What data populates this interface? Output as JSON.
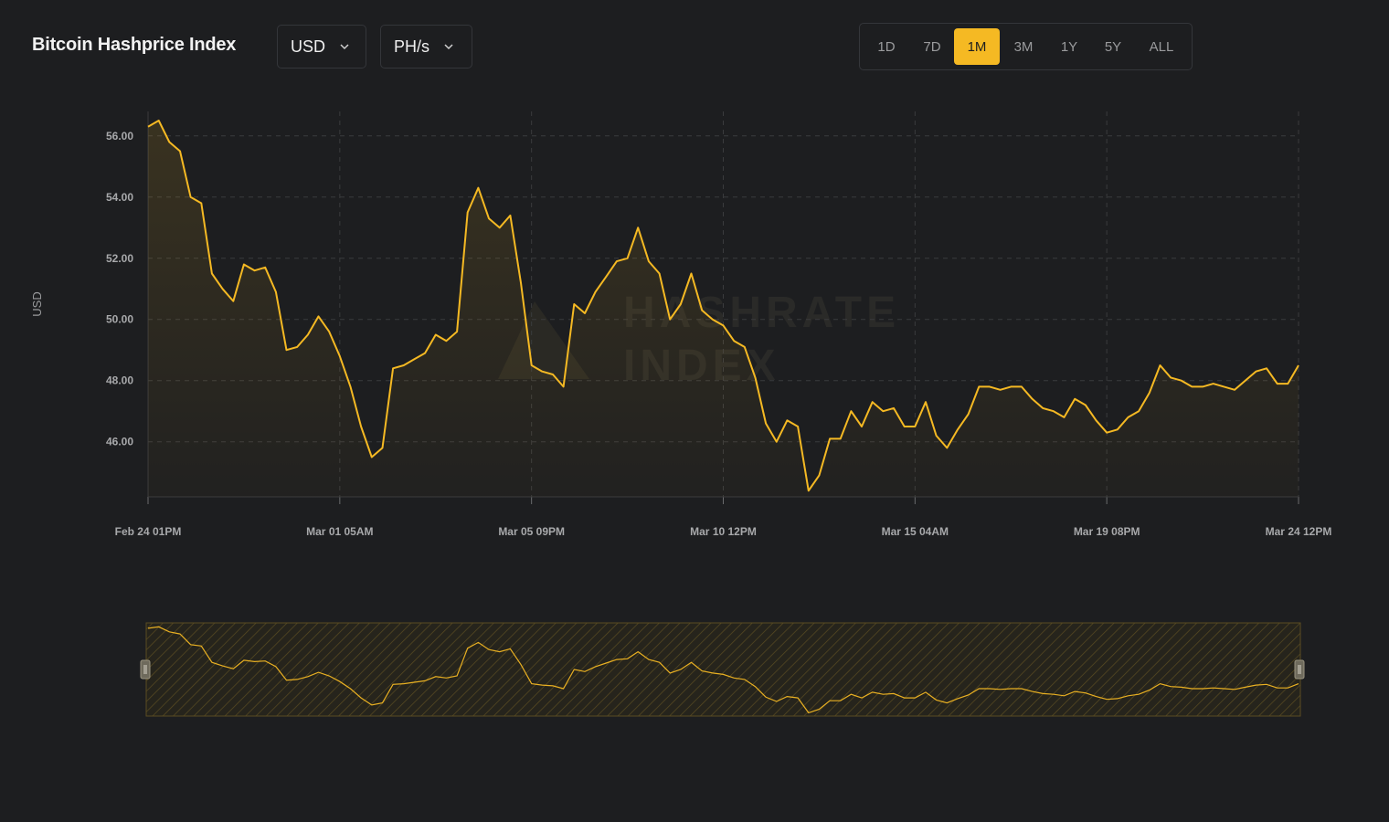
{
  "header": {
    "title": "Bitcoin Hashprice Index",
    "currency": "USD",
    "unit": "PH/s",
    "ranges": [
      "1D",
      "7D",
      "1M",
      "3M",
      "1Y",
      "5Y",
      "ALL"
    ],
    "active_range": "1M"
  },
  "colors": {
    "accent": "#f5b923",
    "background": "#1d1e20",
    "grid": "#3a3b3d"
  },
  "icons": {
    "dropdown": "chevron-down-icon",
    "slider_handle": "drag-handle-icon",
    "watermark": "hashrate-index-logo"
  },
  "watermark": [
    "HASHRATE",
    "INDEX"
  ],
  "chart_data": {
    "type": "area",
    "ylabel": "USD",
    "ylim": [
      44.2,
      56.8
    ],
    "yticks": [
      46,
      48,
      50,
      52,
      54,
      56
    ],
    "ytick_labels": [
      "46.00",
      "48.00",
      "50.00",
      "52.00",
      "54.00",
      "56.00"
    ],
    "xtick_labels": [
      "Feb 24 01PM",
      "Mar 01 05AM",
      "Mar 05 09PM",
      "Mar 10 12PM",
      "Mar 15 04AM",
      "Mar 19 08PM",
      "Mar 24 12PM"
    ],
    "x_start": "Feb 24 01PM",
    "x_end": "Mar 24 12PM",
    "grid": true,
    "series": [
      {
        "values": [
          56.3,
          56.5,
          55.8,
          55.5,
          54.0,
          53.8,
          51.5,
          51.0,
          50.6,
          51.8,
          51.6,
          51.7,
          50.9,
          49.0,
          49.1,
          49.5,
          50.1,
          49.6,
          48.8,
          47.8,
          46.5,
          45.5,
          45.8,
          48.4,
          48.5,
          48.7,
          48.9,
          49.5,
          49.3,
          49.6,
          53.5,
          54.3,
          53.3,
          53.0,
          53.4,
          51.2,
          48.5,
          48.3,
          48.2,
          47.8,
          50.5,
          50.2,
          50.9,
          51.4,
          51.9,
          52.0,
          53.0,
          51.9,
          51.5,
          50.0,
          50.5,
          51.5,
          50.3,
          50.0,
          49.8,
          49.3,
          49.1,
          48.1,
          46.6,
          46.0,
          46.7,
          46.5,
          44.4,
          44.9,
          46.1,
          46.1,
          47.0,
          46.5,
          47.3,
          47.0,
          47.1,
          46.5,
          46.5,
          47.3,
          46.2,
          45.8,
          46.4,
          46.9,
          47.8,
          47.8,
          47.7,
          47.8,
          47.8,
          47.4,
          47.1,
          47.0,
          46.8,
          47.4,
          47.2,
          46.7,
          46.3,
          46.4,
          46.8,
          47.0,
          47.6,
          48.5,
          48.1,
          48.0,
          47.8,
          47.8,
          47.9,
          47.8,
          47.7,
          48.0,
          48.3,
          48.4,
          47.9,
          47.9,
          48.5
        ]
      }
    ]
  }
}
